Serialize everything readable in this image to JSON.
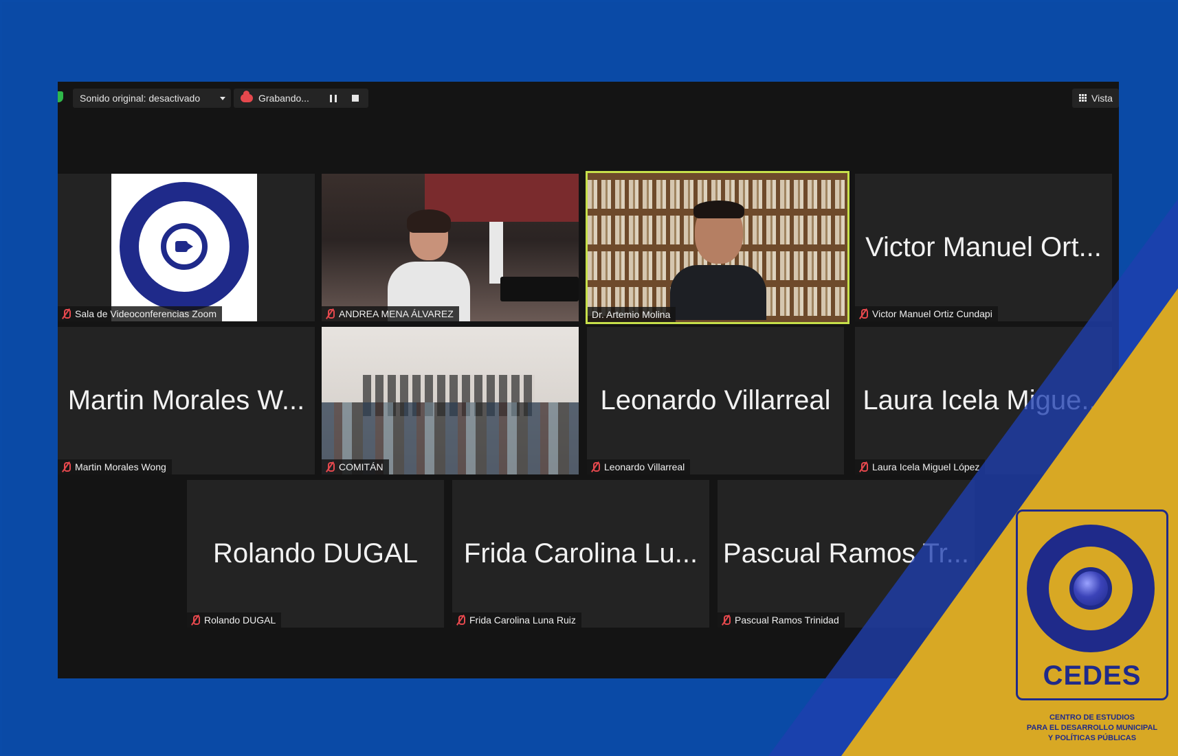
{
  "topbar": {
    "sound_label": "Sonido original: desactivado",
    "recording_label": "Grabando...",
    "view_label": "Vista"
  },
  "tiles": [
    {
      "id": "sala",
      "label": "Sala de Videoconferencias Zoom",
      "type": "logo"
    },
    {
      "id": "andrea",
      "label": "ANDREA MENA  ÁLVAREZ",
      "type": "video"
    },
    {
      "id": "artemio",
      "label": "Dr. Artemio Molina",
      "type": "video",
      "active": true
    },
    {
      "id": "victor",
      "label": "Victor Manuel Ortiz Cundapi",
      "display_name": "Victor Manuel Ort..."
    },
    {
      "id": "martin",
      "label": "Martin Morales Wong",
      "display_name": "Martin Morales W..."
    },
    {
      "id": "comitan",
      "label": "COMITÁN",
      "type": "video"
    },
    {
      "id": "leonardo",
      "label": "Leonardo Villarreal",
      "display_name": "Leonardo Villarreal"
    },
    {
      "id": "laura",
      "label": "Laura Icela Miguel López",
      "display_name": "Laura Icela Migue..."
    },
    {
      "id": "rolando",
      "label": "Rolando DUGAL",
      "display_name": "Rolando DUGAL"
    },
    {
      "id": "frida",
      "label": "Frida Carolina Luna Ruiz",
      "display_name": "Frida Carolina Lu..."
    },
    {
      "id": "pascual",
      "label": "Pascual Ramos Trinidad",
      "display_name": "Pascual Ramos Tr..."
    }
  ],
  "branding": {
    "name": "CEDES",
    "subtitle_line1": "CENTRO DE ESTUDIOS",
    "subtitle_line2": "PARA EL DESARROLLO MUNICIPAL",
    "subtitle_line3": "Y POLÍTICAS PÚBLICAS"
  },
  "colors": {
    "frame_blue": "#0a4ba8",
    "brand_gold": "#d8a824",
    "brand_navy": "#1f2a8a",
    "active_speaker": "#c7e04a",
    "mute_red": "#e5484d"
  }
}
